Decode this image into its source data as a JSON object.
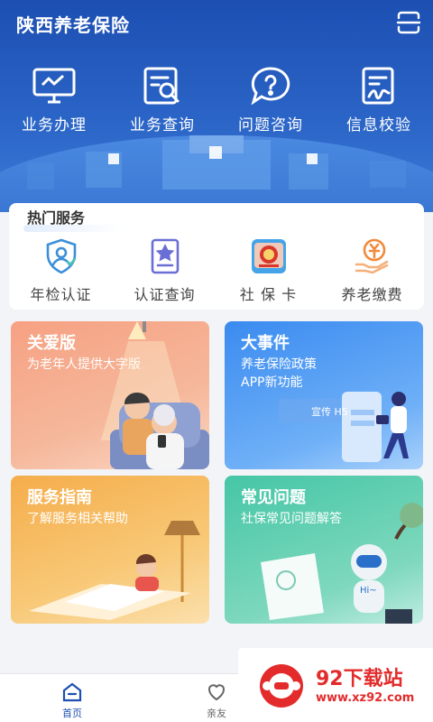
{
  "header": {
    "title": "陕西养老保险"
  },
  "nav": [
    {
      "label": "业务办理",
      "icon": "monitor-icon"
    },
    {
      "label": "业务查询",
      "icon": "search-doc-icon"
    },
    {
      "label": "问题咨询",
      "icon": "question-bubble-icon"
    },
    {
      "label": "信息校验",
      "icon": "edit-doc-icon"
    }
  ],
  "hot": {
    "title": "热门服务",
    "items": [
      {
        "label": "年检认证",
        "icon": "shield-user-icon"
      },
      {
        "label": "认证查询",
        "icon": "star-doc-icon"
      },
      {
        "label": "社 保 卡",
        "icon": "social-card-icon"
      },
      {
        "label": "养老缴费",
        "icon": "yuan-hand-icon"
      }
    ]
  },
  "cards": [
    {
      "title": "关爱版",
      "desc": "为老年人提供大字版"
    },
    {
      "title": "大事件",
      "desc1": "养老保险政策",
      "desc2": "APP新功能",
      "badge": "宣传 H5"
    },
    {
      "title": "服务指南",
      "desc": "了解服务相关帮助"
    },
    {
      "title": "常见问题",
      "desc": "社保常见问题解答",
      "bubble": "Hi~"
    }
  ],
  "tabs": [
    {
      "label": "首页"
    },
    {
      "label": "亲友"
    }
  ],
  "watermark": {
    "title": "92下载站",
    "url": "www.xz92.com"
  },
  "colors": {
    "primary": "#1d4fb2",
    "care": "#f7a183",
    "event": "#3a8bf0",
    "guide": "#f5ad4b",
    "faq": "#45c6a6",
    "watermark": "#e32b2b"
  }
}
